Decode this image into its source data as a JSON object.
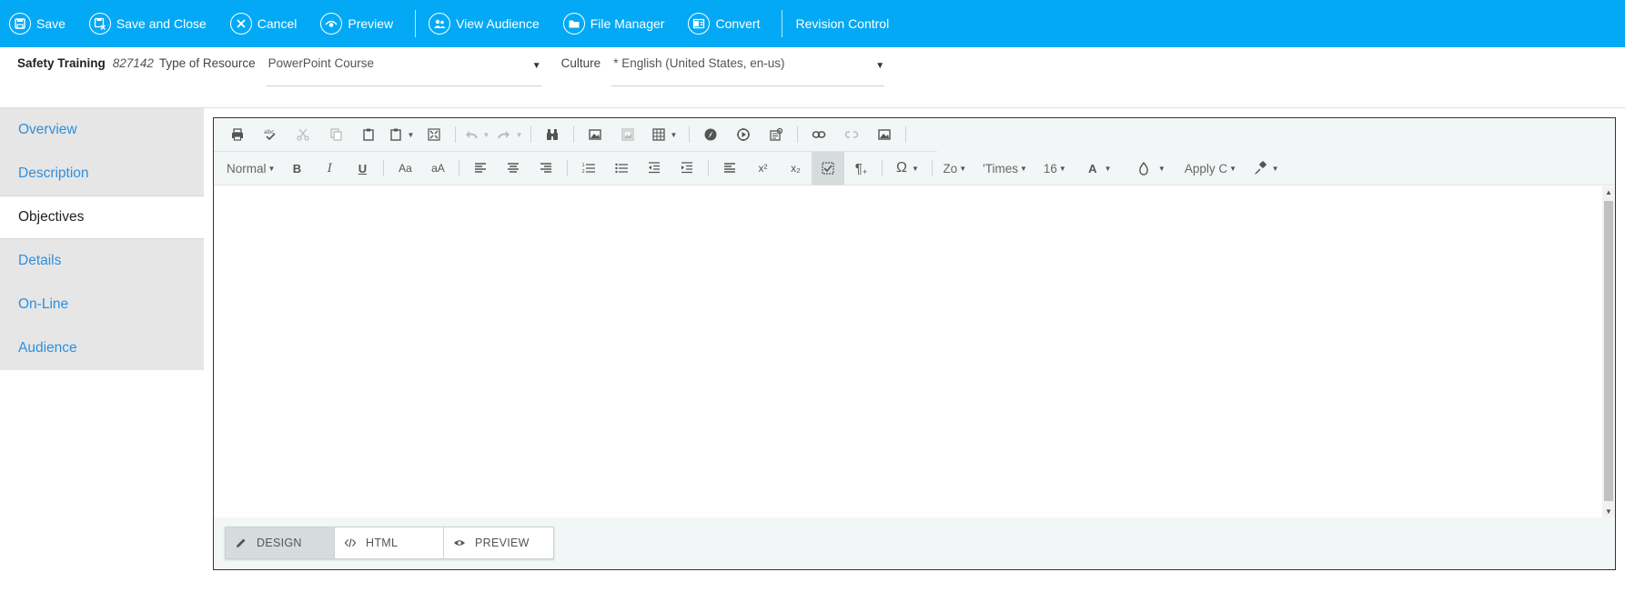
{
  "toolbar": {
    "save": "Save",
    "save_close": "Save and Close",
    "cancel": "Cancel",
    "preview": "Preview",
    "view_audience": "View Audience",
    "file_manager": "File Manager",
    "convert": "Convert",
    "revision_control": "Revision Control",
    "accent_color": "#03a9f4"
  },
  "header": {
    "title": "Safety Training",
    "id": "827142",
    "type_label": "Type of Resource",
    "type_value": "PowerPoint Course",
    "culture_label": "Culture",
    "culture_value": "* English (United States, en-us)"
  },
  "nav": {
    "items": [
      {
        "label": "Overview",
        "active": false
      },
      {
        "label": "Description",
        "active": false
      },
      {
        "label": "Objectives",
        "active": true
      },
      {
        "label": "Details",
        "active": false
      },
      {
        "label": "On-Line",
        "active": false
      },
      {
        "label": "Audience",
        "active": false
      }
    ]
  },
  "editor": {
    "format_block": "Normal",
    "zoom": "Zo",
    "font_name": "'Times",
    "font_size": "16",
    "apply_class": "Apply C",
    "bold": "B",
    "italic": "I",
    "underline": "U",
    "case_a": "Aa",
    "case_b": "aA",
    "font_color": "A",
    "omega": "Ω",
    "pilcrow": "¶",
    "superscript": "x²",
    "subscript": "x₂",
    "modes": {
      "design": "DESIGN",
      "html": "HTML",
      "preview": "PREVIEW"
    }
  }
}
